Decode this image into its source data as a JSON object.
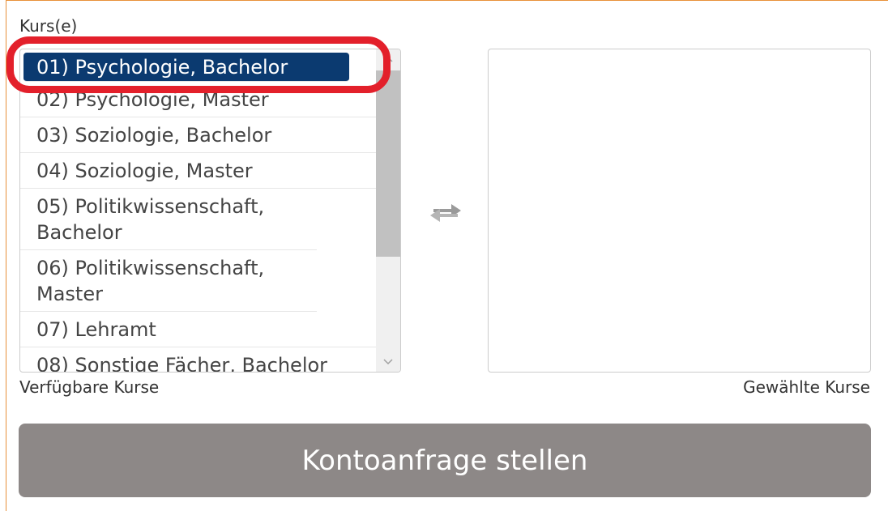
{
  "form": {
    "field_label": "Kurs(e)",
    "available_caption": "Verfügbare Kurse",
    "selected_caption": "Gewählte Kurse",
    "submit_label": "Kontoanfrage stellen"
  },
  "available_courses": [
    {
      "label": "01) Psychologie, Bachelor",
      "selected": true
    },
    {
      "label": "02) Psychologie, Master",
      "selected": false
    },
    {
      "label": "03) Soziologie, Bachelor",
      "selected": false
    },
    {
      "label": "04) Soziologie, Master",
      "selected": false
    },
    {
      "label": "05) Politikwissenschaft, Bachelor",
      "selected": false
    },
    {
      "label": "06) Politikwissenschaft, Master",
      "selected": false
    },
    {
      "label": "07) Lehramt",
      "selected": false
    },
    {
      "label": "08) Sonstige Fächer, Bachelor",
      "selected": false
    }
  ],
  "selected_courses": [],
  "icons": {
    "transfer": "swap-arrows-icon",
    "scroll_up": "chevron-up-icon",
    "scroll_down": "chevron-down-icon"
  },
  "colors": {
    "selection": "#0b3a70",
    "highlight": "#e3202b",
    "button": "#8d8887",
    "frame": "#e8913a"
  }
}
